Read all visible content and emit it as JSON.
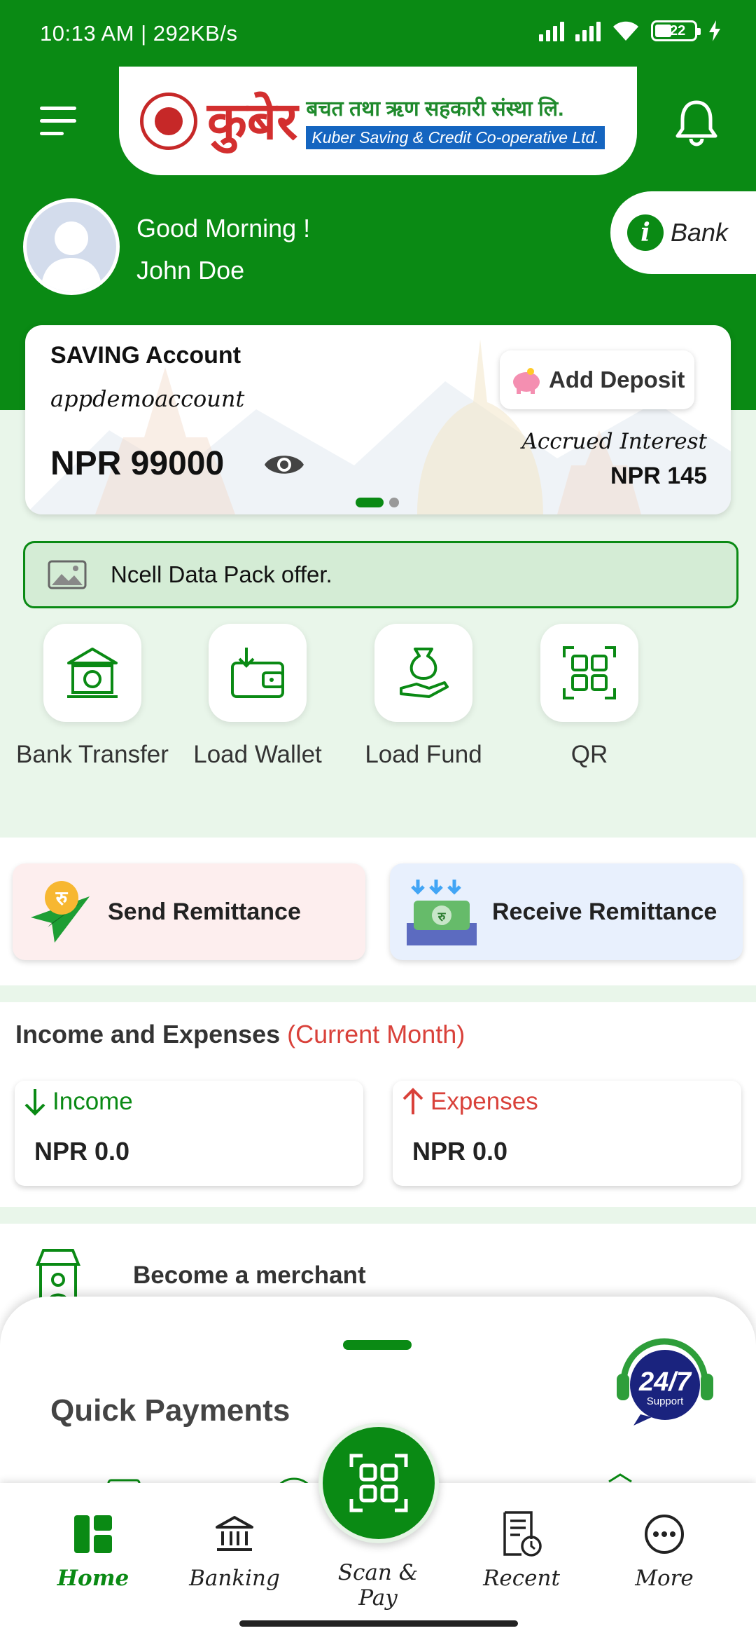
{
  "status_bar": {
    "left_text": "10:13 AM | 292KB/s",
    "battery": "22"
  },
  "header": {
    "logo_devanagari": "कुबेर",
    "logo_nepali": "बचत तथा ऋण सहकारी संस्था लि.",
    "logo_english": "Kuber Saving & Credit Co-operative Ltd."
  },
  "user": {
    "greeting": "Good Morning !",
    "name": "John Doe"
  },
  "info_bank": {
    "label": "Bank"
  },
  "account": {
    "type": "SAVING Account",
    "name": "appdemoaccount",
    "balance": "NPR 99000",
    "add_deposit": "Add Deposit",
    "accrued_label": "Accrued Interest",
    "accrued_value": "NPR 145"
  },
  "banner": {
    "text": "Ncell Data Pack offer."
  },
  "services": [
    {
      "label": "Bank Transfer"
    },
    {
      "label": "Load Wallet"
    },
    {
      "label": "Load Fund"
    },
    {
      "label": "QR"
    }
  ],
  "remittance": {
    "send": "Send Remittance",
    "receive": "Receive Remittance"
  },
  "income_expenses": {
    "title": "Income and Expenses",
    "period": "(Current Month)",
    "income_label": "Income",
    "income_value": "NPR  0.0",
    "expenses_label": "Expenses",
    "expenses_value": "NPR  0.0"
  },
  "merchant": {
    "label": "Become a merchant"
  },
  "quick_payments": {
    "title": "Quick Payments",
    "support_text": "24/7",
    "support_sub": "Support"
  },
  "nav": {
    "home": "Home",
    "banking": "Banking",
    "scan": "Scan & Pay",
    "recent": "Recent",
    "more": "More"
  },
  "colors": {
    "brand_green": "#0a8a14",
    "accent_red": "#d9413a",
    "mint": "#e9f6ea"
  }
}
